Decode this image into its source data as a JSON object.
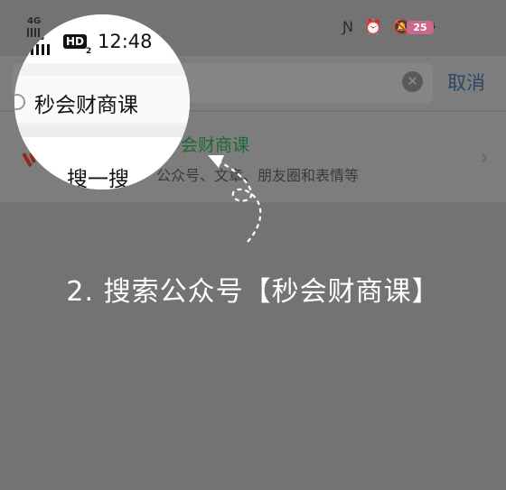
{
  "status_bar": {
    "signal1": "4G",
    "signal2": "4G",
    "network_badge": "HD",
    "network_badge_sub": "2",
    "time": "12:48",
    "time_tail": "8",
    "battery": "25",
    "net_label": "4G"
  },
  "search": {
    "query": "秒会财商课",
    "cancel_label": "取消"
  },
  "result": {
    "title": "会财商课",
    "search_label": "搜一搜",
    "desc": "公众号、文章、朋友圈和表情等"
  },
  "instruction": "2. 搜索公众号【秒会财商课】",
  "colors": {
    "overlay": "#737373",
    "title_green": "#1b6a2f",
    "cancel_blue": "#2a4866",
    "text_white": "#ffffff"
  }
}
